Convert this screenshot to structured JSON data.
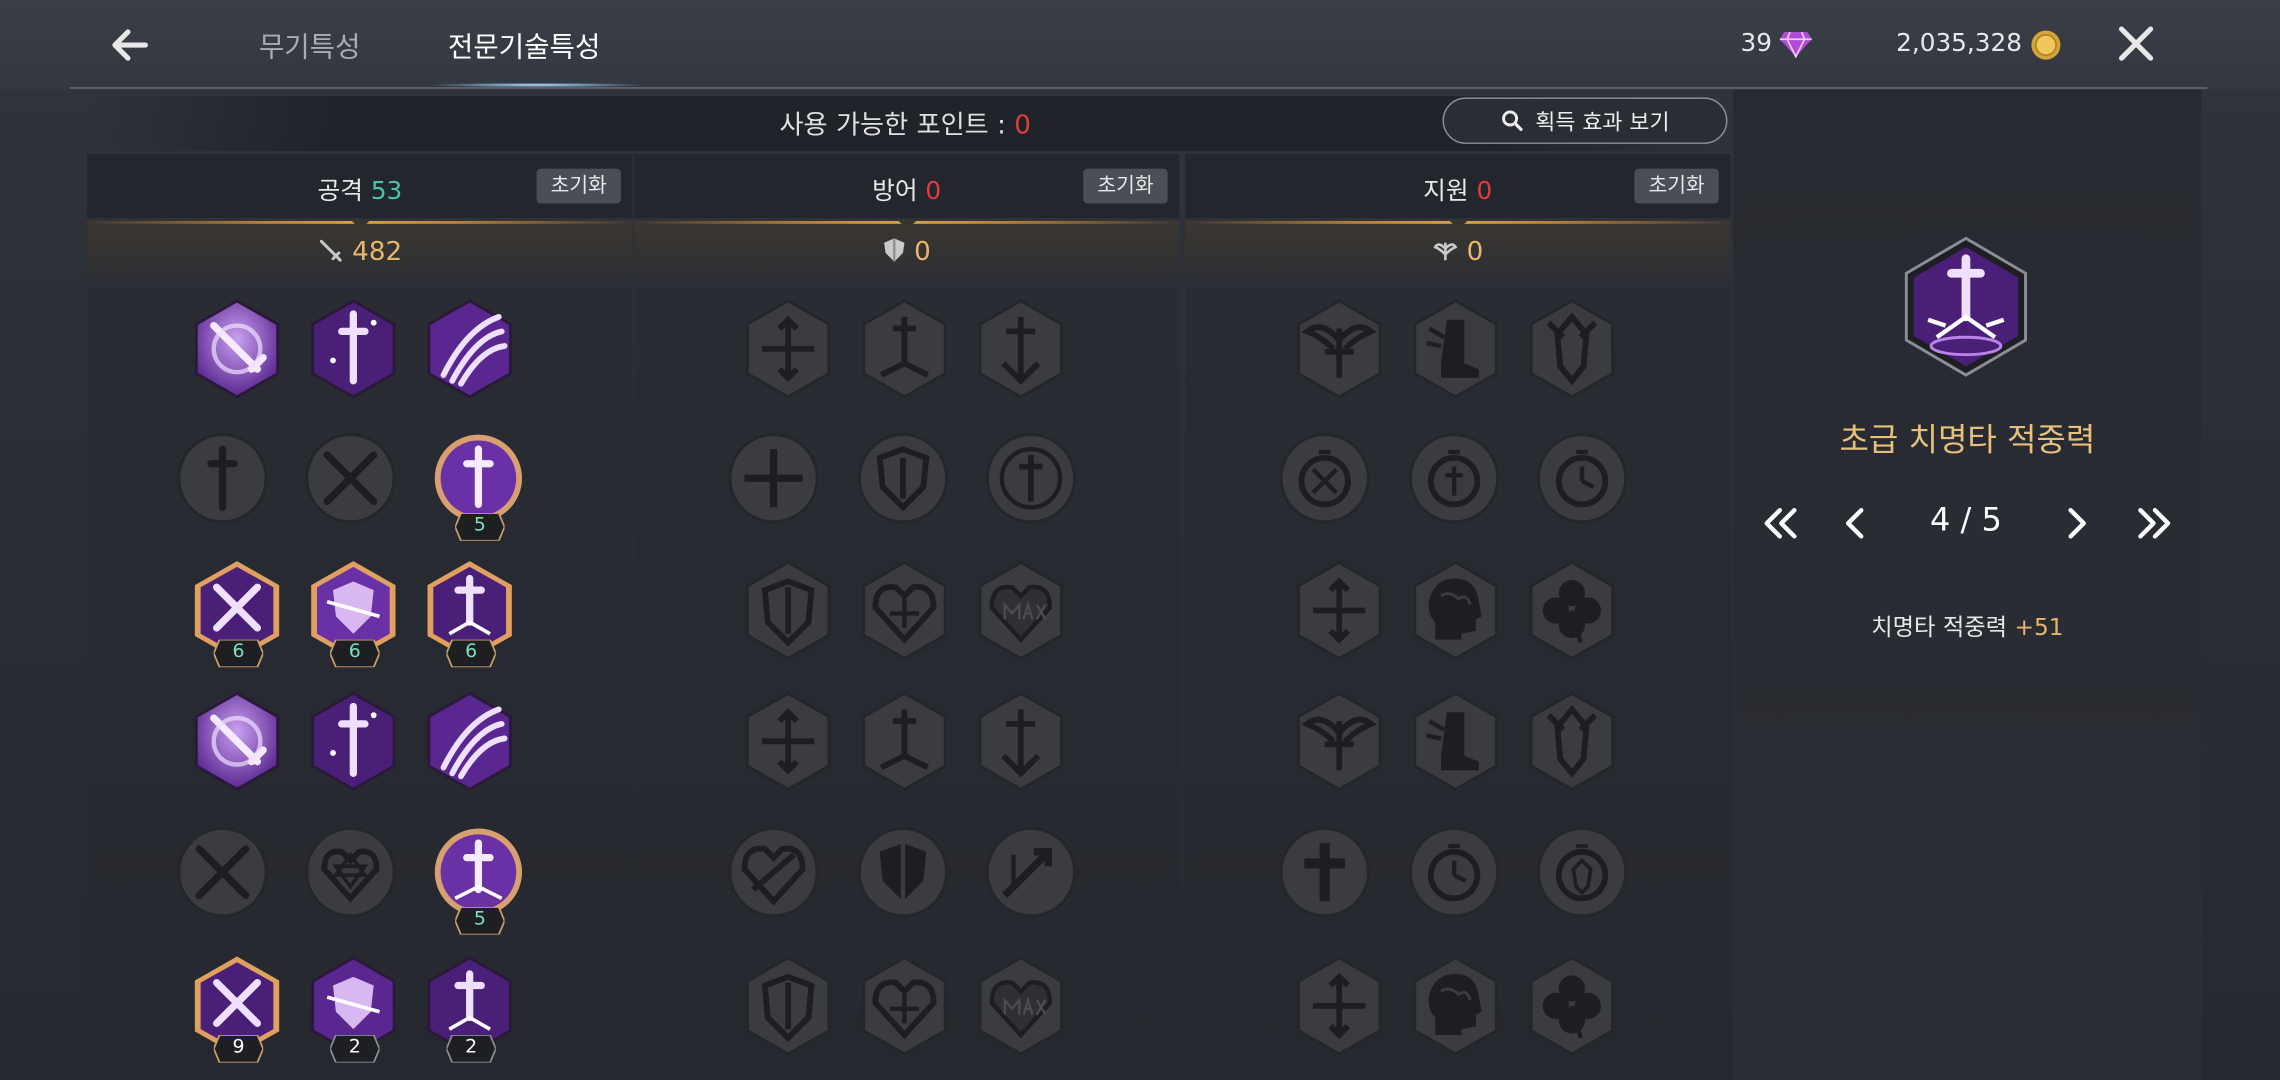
{
  "header": {
    "tabs": [
      {
        "label": "무기특성",
        "active": false
      },
      {
        "label": "전문기술특성",
        "active": true
      }
    ],
    "gems": "39",
    "gold": "2,035,328",
    "gem_icon": "diamond-icon",
    "gold_icon": "coin-icon"
  },
  "points": {
    "label": "사용 가능한 포인트 : ",
    "value": "0"
  },
  "effect_button": {
    "label": "획득 효과 보기",
    "icon": "search-icon"
  },
  "columns": [
    {
      "name": "공격",
      "points": "53",
      "reset": "초기화",
      "stat": "482",
      "stat_icon": "sword-icon"
    },
    {
      "name": "방어",
      "points": "0",
      "reset": "초기화",
      "stat": "0",
      "stat_icon": "shield-icon"
    },
    {
      "name": "지원",
      "points": "0",
      "reset": "초기화",
      "stat": "0",
      "stat_icon": "wings-icon"
    }
  ],
  "selected": {
    "name": "초급 치명타 적중력",
    "page": "4 / 5",
    "effect_label": "치명타 적중력",
    "effect_value": "+51"
  },
  "skill_badges": {
    "attack_r2_c3": "5",
    "attack_r3_c1": "6",
    "attack_r3_c2": "6",
    "attack_r3_c3": "6",
    "attack_r5_c3": "5",
    "attack_r6_c1": "9",
    "attack_r6_c2": "2",
    "attack_r6_c3": "2"
  },
  "colors": {
    "accent_gold": "#e6b66a",
    "points_red": "#e23b3b",
    "points_green": "#49c6a5",
    "skill_purple": "#7b3fb8",
    "locked_gray": "#3a3c40"
  }
}
